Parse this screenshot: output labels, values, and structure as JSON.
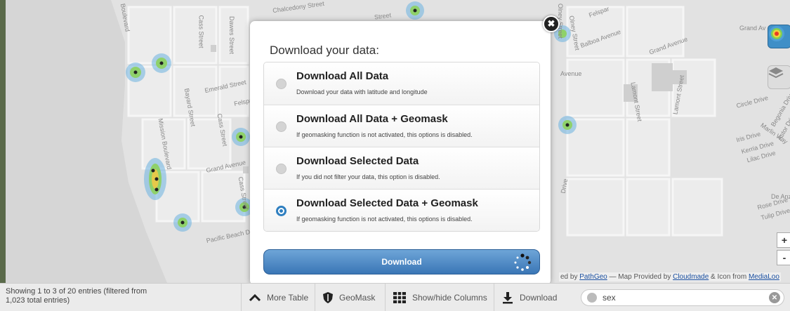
{
  "map": {
    "street_labels": [
      "Boulevard",
      "Cass Street",
      "Dawes Street",
      "Emerald Street",
      "Bayard Street",
      "Felspar",
      "Mission Boulevard",
      "Cass Street",
      "Grand Avenue",
      "Cass Street",
      "Pacific Beach Drive",
      "Chalcedony Street",
      "Street",
      "Felspar",
      "Balboa Avenue",
      "Grand Avenue",
      "Olney Street",
      "Avenue",
      "Lamont Street",
      "Lamont Street",
      "Grand Av",
      "Circle Drive",
      "Marlin Way",
      "Iris Drive",
      "Kerria Drive",
      "Lilac Drive",
      "Begonia Drive",
      "Astor Drive",
      "Rose Drive",
      "Tulip Drive",
      "De Anza",
      "Olney Street",
      "Drive"
    ],
    "attribution": {
      "prefix": "ed by ",
      "link1": "PathGeo",
      "mid": " — Map Provided by ",
      "link2": "Cloudmade",
      "mid2": " & Icon from ",
      "link3": "MediaLoo"
    },
    "zoom_in": "+",
    "zoom_out": "-"
  },
  "modal": {
    "title": "Download your data:",
    "close": "✖",
    "options": [
      {
        "title": "Download All Data",
        "desc": "Download your data with latitude and longitude",
        "checked": false
      },
      {
        "title": "Download All Data + Geomask",
        "desc": "If geomasking function is not activated, this options is disabled.",
        "checked": false
      },
      {
        "title": "Download Selected Data",
        "desc": "If you did not filter your data, this option is disabled.",
        "checked": false
      },
      {
        "title": "Download Selected Data + Geomask",
        "desc": "If geomasking function is not activated, this options is disabled.",
        "checked": true
      }
    ],
    "download_button": "Download"
  },
  "bottombar": {
    "entries": "Showing 1 to 3 of 20 entries (filtered from 1,023 total entries)",
    "more_table": "More Table",
    "geomask": "GeoMask",
    "show_hide_columns": "Show/hide Columns",
    "download": "Download",
    "search_value": "sex"
  },
  "colors": {
    "accent": "#3a76b6",
    "map_bg": "#e2e2e2"
  }
}
